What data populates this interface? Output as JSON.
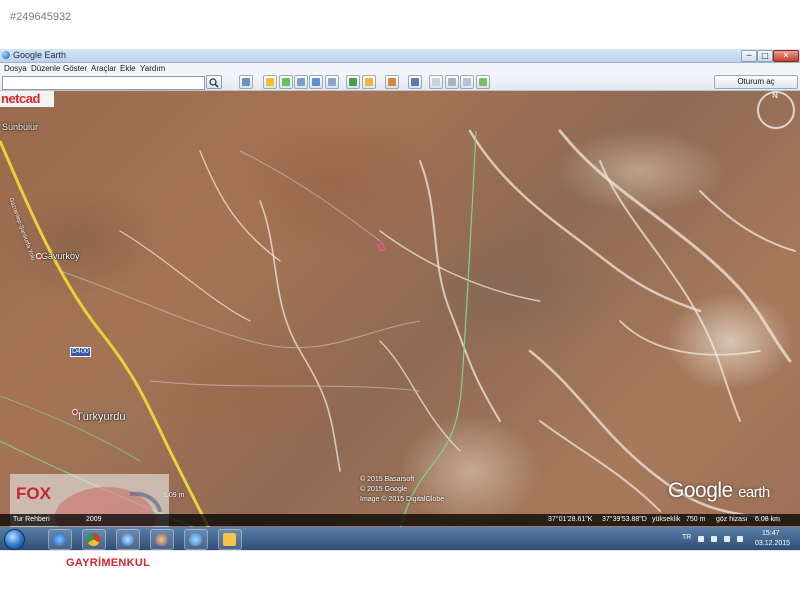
{
  "listing_id": "#249645932",
  "window": {
    "title": "Google Earth",
    "controls": {
      "minimize": "─",
      "maximize": "□",
      "close": "✕"
    }
  },
  "menu": [
    "Dosya",
    "Düzenle",
    "Göster",
    "Araçlar",
    "Ekle",
    "Yardım"
  ],
  "toolbar": {
    "search_value": "",
    "sign_in_label": "Oturum aç",
    "icons": [
      "sidebar-toggle-icon",
      "placemark-icon",
      "polygon-icon",
      "path-icon",
      "image-overlay-icon",
      "record-tour-icon",
      "historical-imagery-icon",
      "sunlight-icon",
      "planets-icon",
      "ruler-icon",
      "email-icon",
      "print-icon",
      "save-image-icon",
      "maps-icon"
    ]
  },
  "map": {
    "brand_overlay": "netcad",
    "places": [
      {
        "name": "Sünbülür"
      },
      {
        "name": "Gavurköy"
      },
      {
        "name": "Türkyurdu"
      }
    ],
    "road_shield": "D400",
    "road_name": "Gaziantep-Şanlıurfa Yolu",
    "north_label": "N",
    "copyright_lines": [
      "© 2015 Basarsoft",
      "© 2015 Google",
      "Image © 2015 DigitalGlobe"
    ],
    "logo_main": "Google",
    "logo_sub": "earth",
    "scale_text": "1.09 m"
  },
  "watermark": {
    "brand": "FOX",
    "tour_guide": "Tur Rehberi",
    "year": "2009",
    "agency": "GAYRİMENKUL"
  },
  "statusbar": {
    "latitude": "37°01'28.61\"K",
    "longitude": "37°39'53.88\"D",
    "elevation_label": "yükseklik",
    "elevation_value": "750 m",
    "eye_alt_label": "göz hizası",
    "eye_alt_value": "6.08 km"
  },
  "taskbar": {
    "language": "TR",
    "time": "15:47",
    "date": "03.12.2015"
  },
  "colors": {
    "taskbar": "#2f4d73",
    "agency_red": "#d4262c",
    "road_yellow": "#e8d23a",
    "boundary_green": "#7fd38a"
  }
}
